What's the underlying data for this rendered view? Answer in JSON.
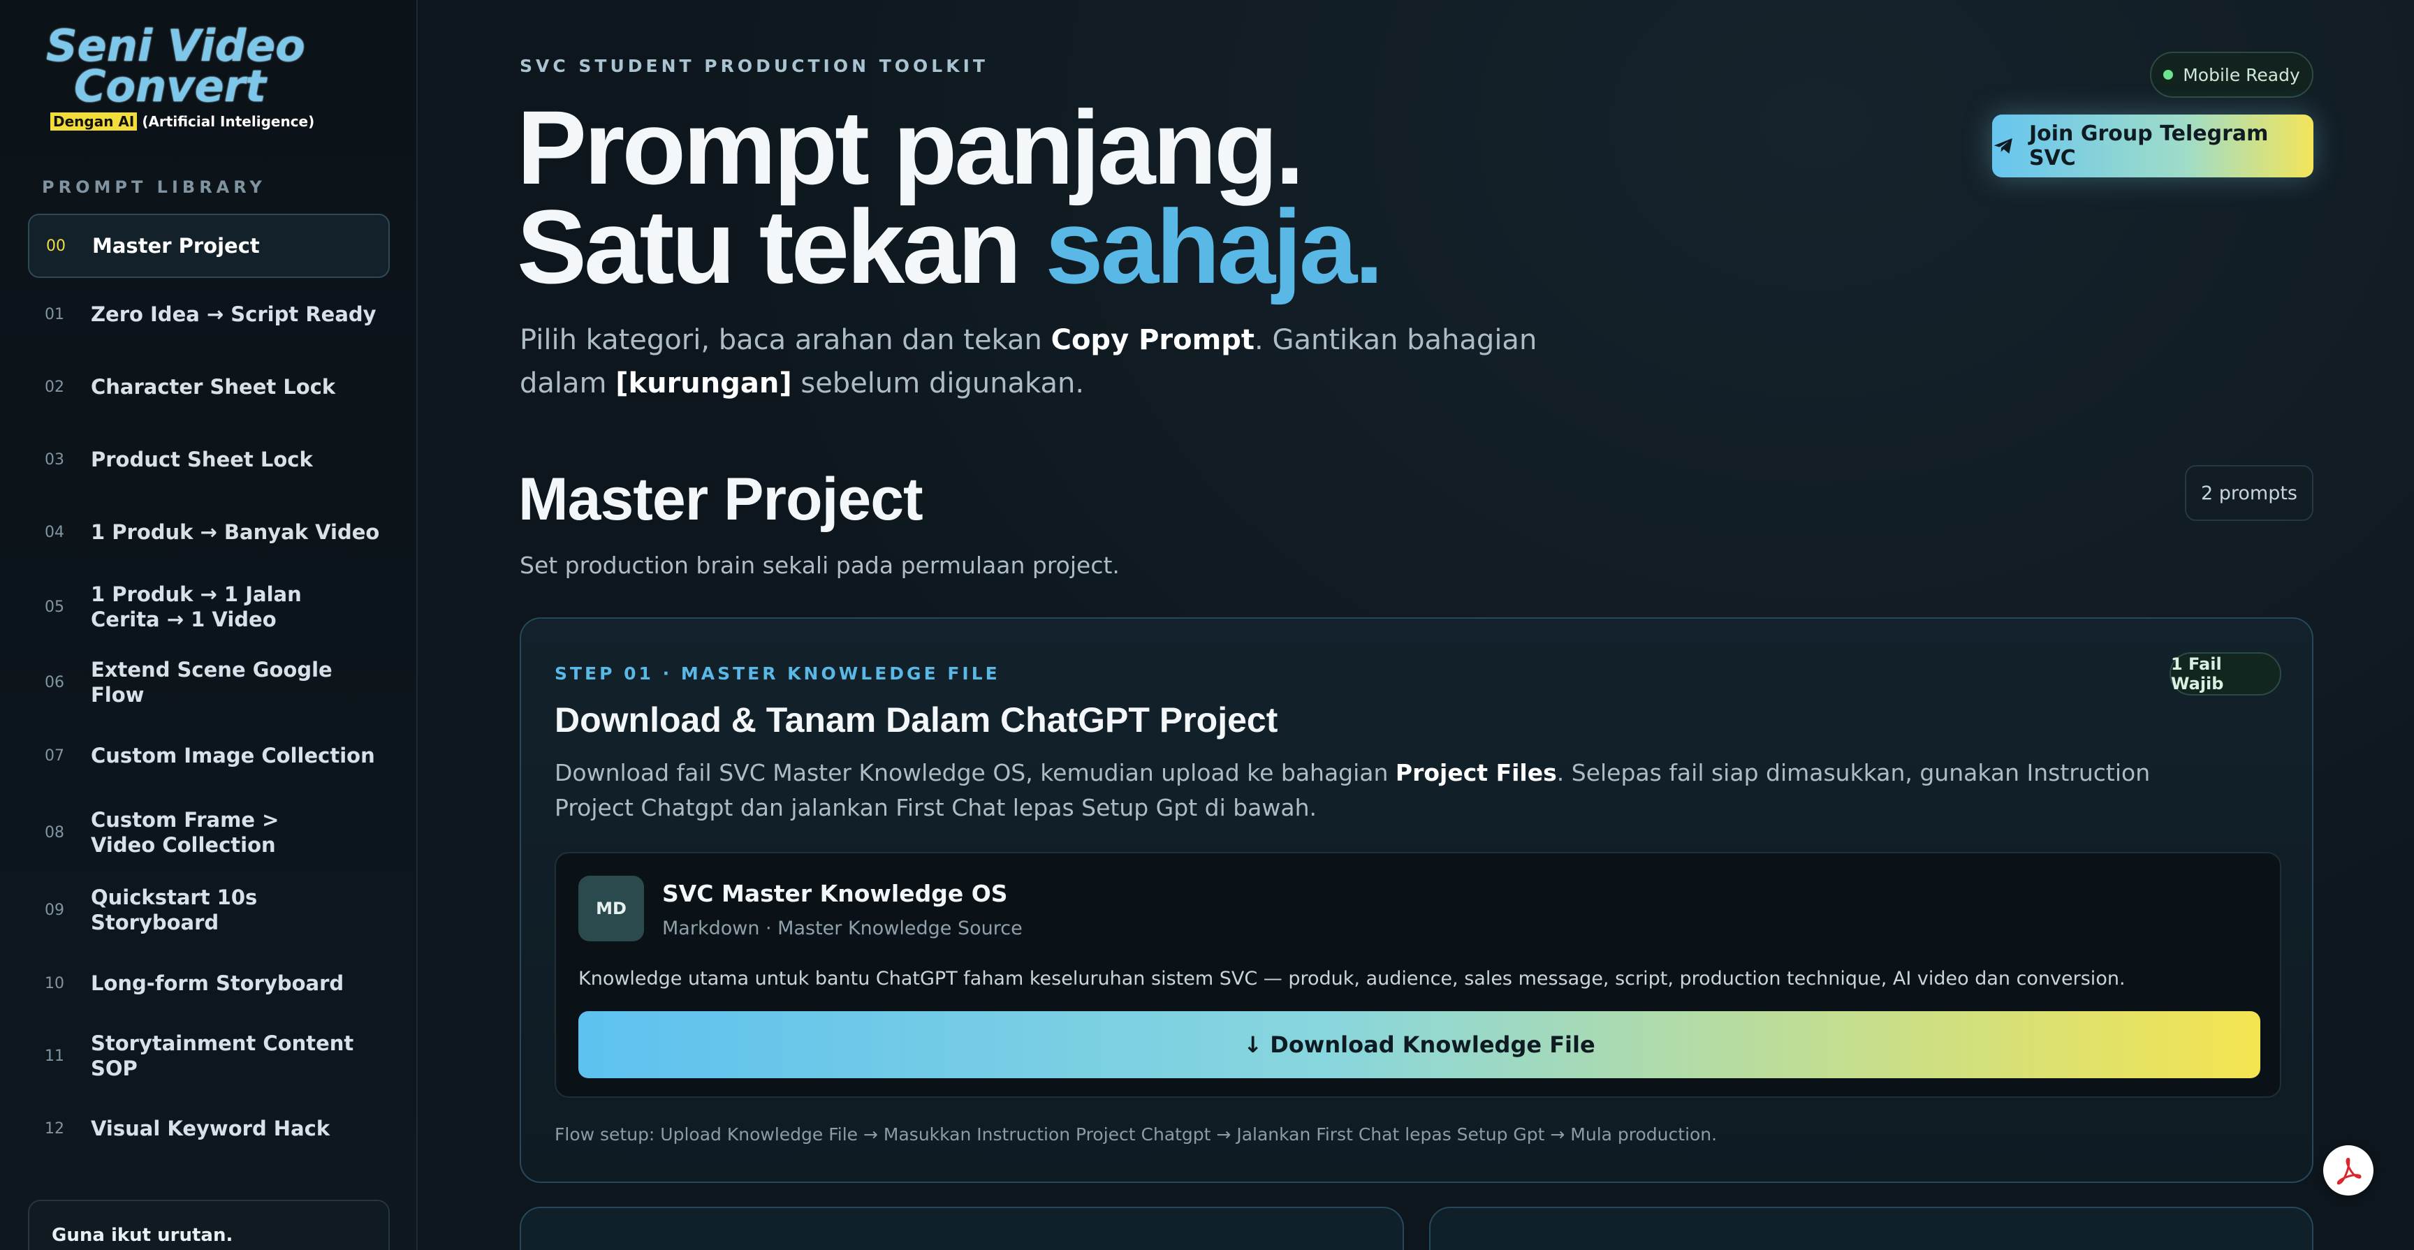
{
  "brand": {
    "line1": "Seni Video",
    "line2": "Convert",
    "sub_highlight": "Dengan AI",
    "sub_rest": "(Artificial Inteligence)"
  },
  "sidebar": {
    "title": "PROMPT LIBRARY",
    "items": [
      {
        "num": "00",
        "label": "Master Project",
        "active": true
      },
      {
        "num": "01",
        "label": "Zero Idea → Script Ready"
      },
      {
        "num": "02",
        "label": "Character Sheet Lock"
      },
      {
        "num": "03",
        "label": "Product Sheet Lock"
      },
      {
        "num": "04",
        "label": "1 Produk → Banyak Video"
      },
      {
        "num": "05",
        "label": "1 Produk → 1 Jalan Cerita → 1 Video"
      },
      {
        "num": "06",
        "label": "Extend Scene Google Flow"
      },
      {
        "num": "07",
        "label": "Custom Image Collection"
      },
      {
        "num": "08",
        "label": "Custom Frame > Video Collection"
      },
      {
        "num": "09",
        "label": "Quickstart 10s Storyboard"
      },
      {
        "num": "10",
        "label": "Long-form Storyboard"
      },
      {
        "num": "11",
        "label": "Storytainment Content SOP"
      },
      {
        "num": "12",
        "label": "Visual Keyword Hack"
      }
    ],
    "note": "Guna ikut urutan."
  },
  "header": {
    "eyebrow": "SVC STUDENT PRODUCTION TOOLKIT",
    "hero_line1": "Prompt panjang.",
    "hero_line2_plain": "Satu tekan ",
    "hero_line2_accent": "sahaja.",
    "sub_a": "Pilih kategori, baca arahan dan tekan ",
    "sub_b": "Copy Prompt",
    "sub_c": ". Gantikan bahagian dalam ",
    "sub_d": "[kurungan]",
    "sub_e": " sebelum digunakan.",
    "mobile_badge": "Mobile Ready",
    "telegram_button": "Join Group Telegram SVC"
  },
  "section": {
    "title": "Master Project",
    "subtitle": "Set production brain sekali pada permulaan project.",
    "count": "2 prompts"
  },
  "card": {
    "step": "STEP 01 · MASTER KNOWLEDGE FILE",
    "badge": "1 Fail Wajib",
    "title": "Download & Tanam Dalam ChatGPT Project",
    "desc_a": "Download fail SVC Master Knowledge OS, kemudian upload ke bahagian ",
    "desc_b": "Project Files",
    "desc_c": ". Selepas fail siap dimasukkan, gunakan Instruction Project Chatgpt dan jalankan First Chat lepas Setup Gpt di bawah.",
    "file": {
      "icon_text": "MD",
      "name": "SVC Master Knowledge OS",
      "meta": "Markdown · Master Knowledge Source",
      "desc": "Knowledge utama untuk bantu ChatGPT faham keseluruhan sistem SVC — produk, audience, sales message, script, production technique, AI video dan conversion.",
      "download_label": "↓ Download Knowledge File"
    },
    "flow_note": "Flow setup: Upload Knowledge File → Masukkan Instruction Project Chatgpt → Jalankan First Chat lepas Setup Gpt → Mula production."
  },
  "colors": {
    "accent": "#5ab8e6",
    "gold": "#f3e45a",
    "background": "#0d161d"
  }
}
